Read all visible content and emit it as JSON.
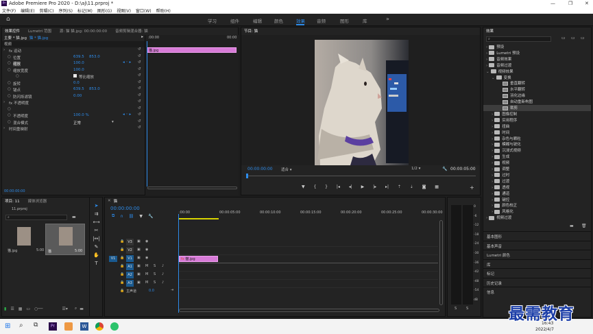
{
  "titlebar": {
    "title": "Adobe Premiere Pro 2020 - D:\\aj\\11.prproj *"
  },
  "menu": [
    "文件(F)",
    "编辑(E)",
    "剪辑(C)",
    "序列(S)",
    "标记(M)",
    "图形(G)",
    "视图(V)",
    "窗口(W)",
    "帮助(H)"
  ],
  "workspaces": [
    "学习",
    "组件",
    "编辑",
    "颜色",
    "效果",
    "音频",
    "图形",
    "库"
  ],
  "workspace_active": "效果",
  "source_panel": {
    "tabs": [
      "效果控件",
      "Lumetri 范围",
      "源: 猫 猫.jpg: 00:00:00:00",
      "音频剪辑混合器: 猫"
    ],
    "breadcrumb_master": "主要 * 猫.jpg",
    "breadcrumb_seq": "猫 * 猫.jpg",
    "video_header": "视频",
    "ruler_start": ":00:00",
    "ruler_end": "00:00",
    "clip_label": "猫.jpg",
    "rows": [
      {
        "label": "fx  运动",
        "indent": 2,
        "v1": "",
        "v2": ""
      },
      {
        "label": "位置",
        "indent": 8,
        "v1": "639.5",
        "v2": "853.0"
      },
      {
        "label": "缩放",
        "indent": 8,
        "v1": "100.0",
        "v2": ""
      },
      {
        "label": "缩放宽度",
        "indent": 8,
        "v1": "100.0",
        "v2": ""
      },
      {
        "label": "等比缩放",
        "indent": 20,
        "v1": "",
        "v2": ""
      },
      {
        "label": "旋转",
        "indent": 8,
        "v1": "0.0",
        "v2": ""
      },
      {
        "label": "锚点",
        "indent": 8,
        "v1": "639.5",
        "v2": "853.0"
      },
      {
        "label": "防闪烁滤镜",
        "indent": 8,
        "v1": "0.00",
        "v2": ""
      },
      {
        "label": "fx  不透明度",
        "indent": 2,
        "v1": "",
        "v2": ""
      },
      {
        "label": "",
        "indent": 8,
        "v1": "",
        "v2": ""
      },
      {
        "label": "不透明度",
        "indent": 8,
        "v1": "100.0 %",
        "v2": ""
      },
      {
        "label": "混合模式",
        "indent": 8,
        "v1": "正常",
        "v2": ""
      },
      {
        "label": "时间重映射",
        "indent": 2,
        "v1": "",
        "v2": ""
      }
    ],
    "timecode": "00:00:00:00"
  },
  "program_panel": {
    "title": "节目: 猫",
    "timecode": "00:00:00:00",
    "fit": "适合",
    "quality": "1/2",
    "duration": "00:00:05:00"
  },
  "project_panel": {
    "tabs": [
      "项目: 11",
      "媒体浏览器"
    ],
    "file": "11.prproj",
    "items": [
      {
        "name": "猫.jpg",
        "dur": "5:00"
      },
      {
        "name": "猫",
        "dur": "5:00"
      }
    ]
  },
  "timeline": {
    "tab": "猫",
    "timecode": "00:00:00:00",
    "ruler": [
      ":00:00",
      "00:00:05:00",
      "00:00:10:00",
      "00:00:15:00",
      "00:00:20:00",
      "00:00:25:00",
      "00:00:30:00"
    ],
    "tracks": [
      "V3",
      "V2",
      "V1",
      "A1",
      "A2",
      "A3"
    ],
    "source_track": "V1",
    "master": "主声道",
    "master_val": "0.0",
    "clip": "猫.jpg"
  },
  "audio_meter": {
    "scale": [
      "0",
      "-6",
      "-12",
      "-18",
      "-24",
      "-30",
      "-36",
      "-42",
      "-48",
      "-54",
      "dB"
    ],
    "bottom": [
      "S",
      "S"
    ]
  },
  "effects_panel": {
    "title": "效果",
    "tree": [
      {
        "label": "预设",
        "depth": 0,
        "kind": "folder"
      },
      {
        "label": "Lumetri 预设",
        "depth": 0,
        "kind": "folder"
      },
      {
        "label": "音频效果",
        "depth": 0,
        "kind": "folder"
      },
      {
        "label": "音频过渡",
        "depth": 0,
        "kind": "folder"
      },
      {
        "label": "视频效果",
        "depth": 0,
        "kind": "folder"
      },
      {
        "label": "变换",
        "depth": 1,
        "kind": "folder"
      },
      {
        "label": "垂直翻转",
        "depth": 2,
        "kind": "preset"
      },
      {
        "label": "水平翻转",
        "depth": 2,
        "kind": "preset"
      },
      {
        "label": "羽化边缘",
        "depth": 2,
        "kind": "preset"
      },
      {
        "label": "自动重新构图",
        "depth": 2,
        "kind": "preset"
      },
      {
        "label": "裁剪",
        "depth": 2,
        "kind": "preset"
      },
      {
        "label": "图像控制",
        "depth": 1,
        "kind": "folder"
      },
      {
        "label": "实用程序",
        "depth": 1,
        "kind": "folder"
      },
      {
        "label": "扭曲",
        "depth": 1,
        "kind": "folder"
      },
      {
        "label": "时间",
        "depth": 1,
        "kind": "folder"
      },
      {
        "label": "杂色与颗粒",
        "depth": 1,
        "kind": "folder"
      },
      {
        "label": "模糊与锐化",
        "depth": 1,
        "kind": "folder"
      },
      {
        "label": "沉浸式视频",
        "depth": 1,
        "kind": "folder"
      },
      {
        "label": "生成",
        "depth": 1,
        "kind": "folder"
      },
      {
        "label": "视频",
        "depth": 1,
        "kind": "folder"
      },
      {
        "label": "调整",
        "depth": 1,
        "kind": "folder"
      },
      {
        "label": "过时",
        "depth": 1,
        "kind": "folder"
      },
      {
        "label": "过渡",
        "depth": 1,
        "kind": "folder"
      },
      {
        "label": "透视",
        "depth": 1,
        "kind": "folder"
      },
      {
        "label": "通道",
        "depth": 1,
        "kind": "folder"
      },
      {
        "label": "键控",
        "depth": 1,
        "kind": "folder"
      },
      {
        "label": "颜色校正",
        "depth": 1,
        "kind": "folder"
      },
      {
        "label": "风格化",
        "depth": 1,
        "kind": "folder"
      },
      {
        "label": "视频过渡",
        "depth": 0,
        "kind": "folder"
      }
    ],
    "sections": [
      "基本图形",
      "基本声音",
      "Lumetri 颜色",
      "库",
      "标记",
      "历史记录",
      "信息"
    ]
  },
  "taskbar": {
    "time": "16:43",
    "date": "2022/4/7"
  },
  "watermark": "最需教育",
  "colors": {
    "accent": "#2d8ceb",
    "clip": "#d77bd7"
  }
}
